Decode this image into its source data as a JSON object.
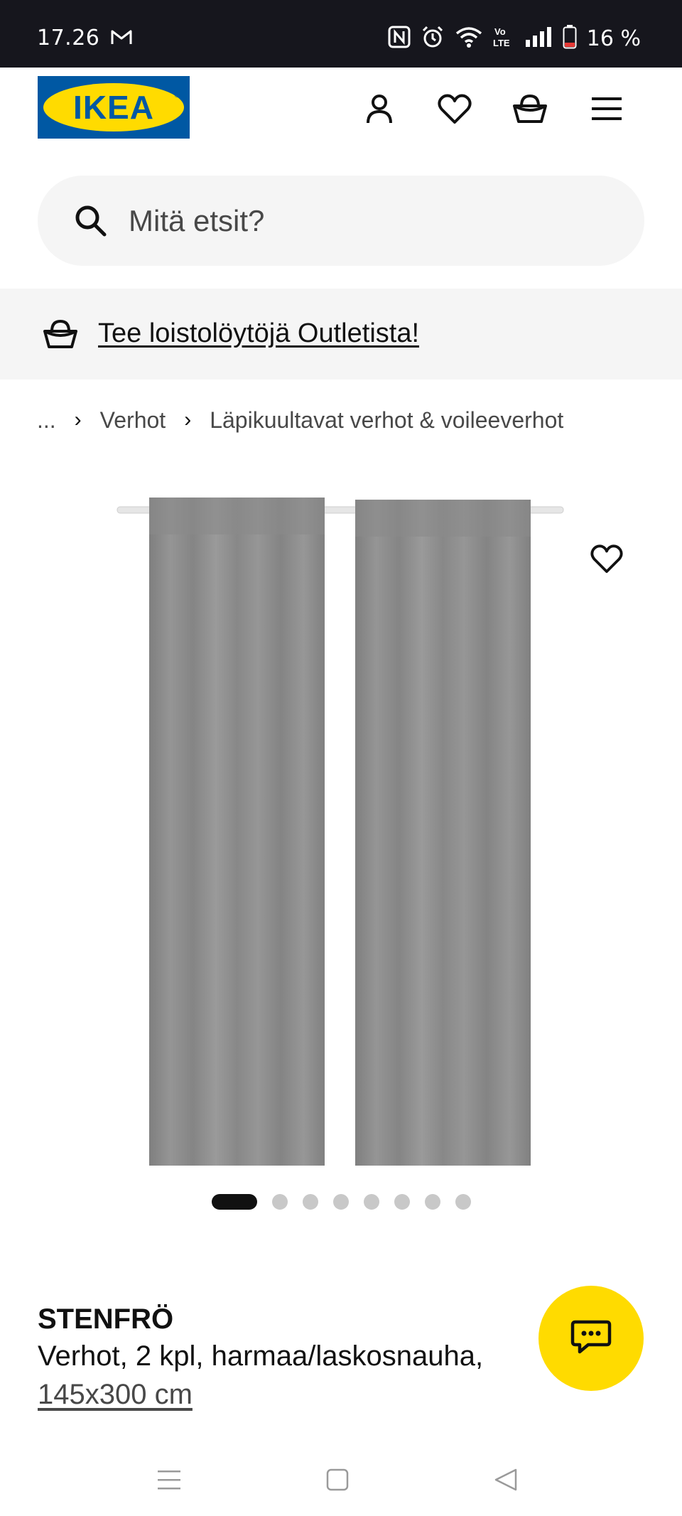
{
  "status_bar": {
    "time": "17.26",
    "battery_percent": "16 %",
    "icons": [
      "gmail-icon",
      "nfc-icon",
      "alarm-icon",
      "wifi-icon",
      "volte-icon",
      "signal-icon",
      "battery-icon"
    ],
    "volte_text": "Vo\nLTE"
  },
  "header": {
    "logo_text": "IKEA",
    "icons": [
      "account-icon",
      "wishlist-heart-icon",
      "shopping-basket-icon",
      "menu-icon"
    ]
  },
  "search": {
    "placeholder": "Mitä etsit?"
  },
  "banner": {
    "text": "Tee loistolöytöjä Outletista!"
  },
  "breadcrumb": {
    "items": [
      "...",
      "Verhot",
      "Läpikuultavat verhot & voileeverhot"
    ]
  },
  "gallery": {
    "image_count": 8,
    "active_index": 0
  },
  "product": {
    "name": "STENFRÖ",
    "description": "Verhot, 2 kpl, harmaa/laskosnauha,",
    "size": "145x300 cm"
  },
  "colors": {
    "ikea_blue": "#0058a3",
    "ikea_yellow": "#ffdb00",
    "status_bar_bg": "#16161d",
    "curtain_grey": "#8e8e8e"
  },
  "android_nav": {
    "icons": [
      "recent-apps-icon",
      "home-icon",
      "back-icon"
    ]
  }
}
